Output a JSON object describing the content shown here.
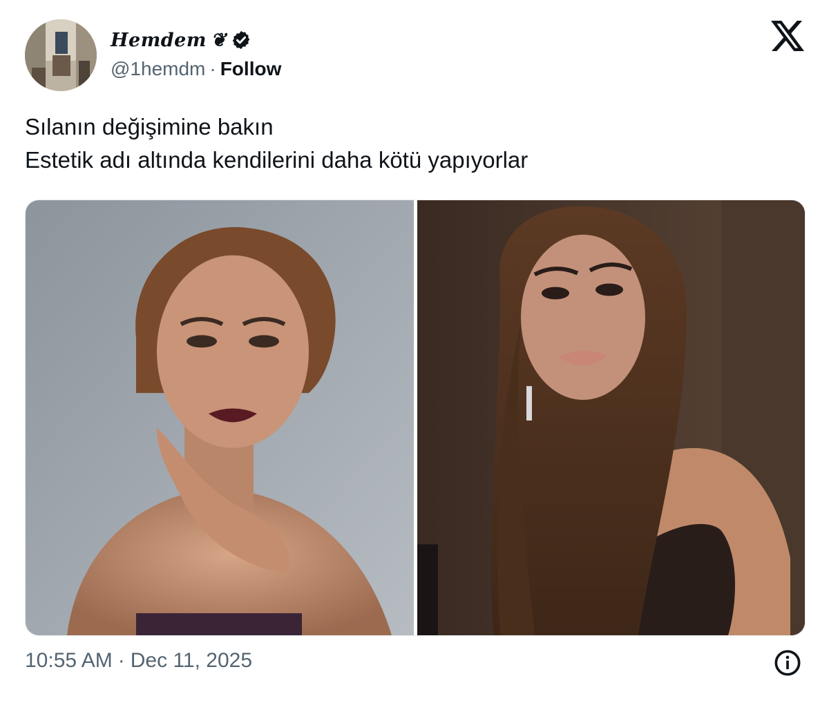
{
  "author": {
    "display_name": "Hemdem",
    "name_emoji": "❦",
    "handle": "@1hemdm",
    "separator": "·",
    "follow_label": "Follow",
    "verified": true
  },
  "platform_icon": "x-logo-icon",
  "tweet": {
    "lines": [
      "Sılanın değişimine bakın",
      "Estetik adı altında kendilerini daha kötü yapıyorlar"
    ]
  },
  "media": {
    "images": [
      {
        "icon": "portrait-short-hair-photo"
      },
      {
        "icon": "portrait-long-hair-photo"
      }
    ]
  },
  "meta": {
    "time": "10:55 AM",
    "separator": "·",
    "date": "Dec 11, 2025",
    "info_icon": "info-icon"
  },
  "colors": {
    "text_primary": "#0f1419",
    "text_secondary": "#536471"
  }
}
